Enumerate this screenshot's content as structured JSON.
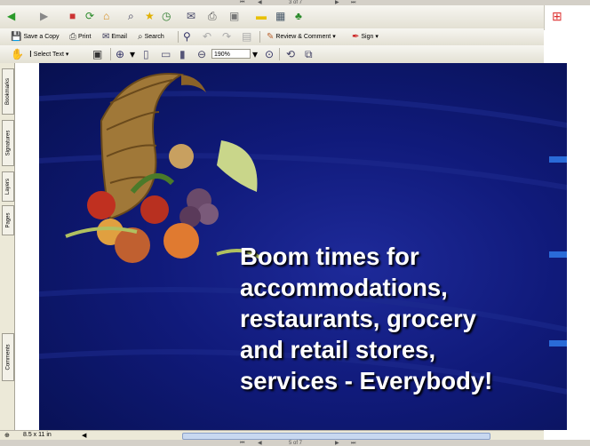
{
  "nav": {
    "top_page_display": "3 of 7",
    "bottom_page_display": "5 of 7"
  },
  "toolbar2": {
    "save_copy_label": "Save a Copy",
    "print_label": "Print",
    "email_label": "Email",
    "search_label": "Search",
    "review_label": "Review & Comment",
    "sign_label": "Sign"
  },
  "toolbar3": {
    "select_text_label": "Select Text",
    "zoom_value": "190%"
  },
  "side_tabs": [
    "Bookmarks",
    "Signatures",
    "Layers",
    "Pages",
    "Comments"
  ],
  "slide": {
    "lines": [
      "Boom times for",
      "accommodations,",
      "restaurants, grocery",
      "and retail stores,",
      "services - Everybody!"
    ]
  },
  "status": {
    "page_size": "8.5 x 11 in"
  },
  "colors": {
    "slide_bg": "#101a7a",
    "slide_text": "#ffffff",
    "accent_stripe": "#2a6bd8"
  }
}
